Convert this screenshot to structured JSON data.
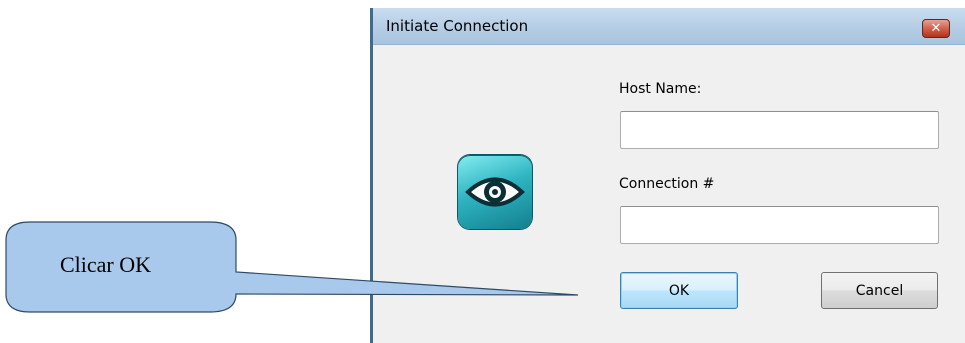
{
  "dialog": {
    "title": "Initiate Connection",
    "close_icon": "close-icon",
    "app_icon": "eye-icon",
    "host_name_label": "Host Name:",
    "host_name_value": "",
    "connection_label": "Connection #",
    "connection_value": "",
    "ok_label": "OK",
    "cancel_label": "Cancel"
  },
  "annotation": {
    "text": "Clicar OK"
  },
  "colors": {
    "callout_fill": "#a9c9ec",
    "callout_stroke": "#2d4a66",
    "titlebar": "#b6cee6",
    "close_button": "#c8432b",
    "icon_teal": "#2fb5c2"
  }
}
